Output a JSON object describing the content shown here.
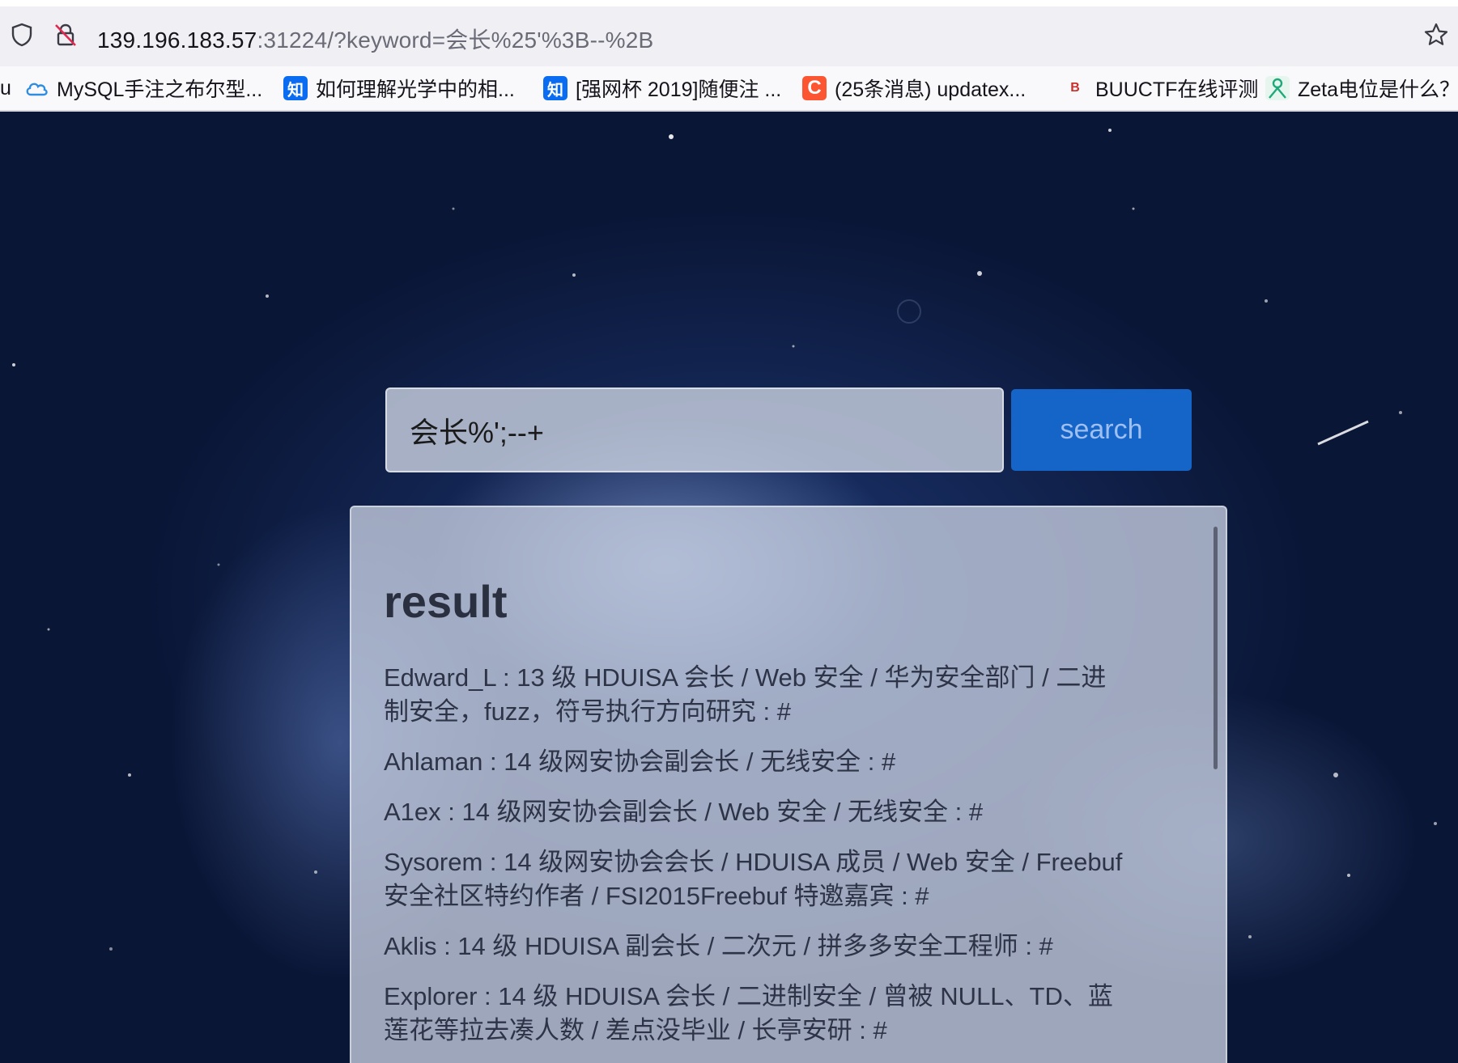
{
  "browser": {
    "url_host": "139.196.183.57",
    "url_rest": ":31224/?keyword=会长%25'%3B--%2B",
    "bookmarks": [
      {
        "label": "u",
        "icon": "partial-bookmark"
      },
      {
        "label": "MySQL手注之布尔型...",
        "icon": "cloud-icon",
        "color": "#2e8de0"
      },
      {
        "label": "如何理解光学中的相...",
        "icon": "zhihu-icon",
        "glyph": "知",
        "color": "#0a6cf0"
      },
      {
        "label": "[强网杯 2019]随便注 ...",
        "icon": "zhihu-icon",
        "glyph": "知",
        "color": "#0a6cf0"
      },
      {
        "label": "(25条消息) updatex...",
        "icon": "csdn-icon",
        "glyph": "C",
        "color": "#fc5531"
      },
      {
        "label": "BUUCTF在线评测",
        "icon": "buuctf-icon",
        "glyph": "B",
        "color": "#c9302c"
      },
      {
        "label": "Zeta电位是什么？",
        "icon": "person-icon",
        "color": "#1fa97a"
      }
    ]
  },
  "search": {
    "value": "会长%';--+",
    "button_label": "search"
  },
  "result": {
    "title": "result",
    "items": [
      "Edward_L : 13 级 HDUISA 会长 / Web 安全 / 华为安全部门 / 二进制安全，fuzz，符号执行方向研究 : #",
      "Ahlaman : 14 级网安协会副会长 / 无线安全 : #",
      "A1ex : 14 级网安协会副会长 / Web 安全 / 无线安全 : #",
      "Sysorem : 14 级网安协会会长 / HDUISA 成员 / Web 安全 / Freebuf 安全社区特约作者 / FSI2015Freebuf 特邀嘉宾 : #",
      "Aklis : 14 级 HDUISA 副会长 / 二次元 / 拼多多安全工程师 : #",
      "Explorer : 14 级 HDUISA 会长 / 二进制安全 / 曾被 NULL、TD、蓝莲花等拉去凑人数 / 差点没毕业 / 长亭安研 : #"
    ]
  },
  "colors": {
    "accent": "#1565c8",
    "background": "#0d1a3a"
  }
}
